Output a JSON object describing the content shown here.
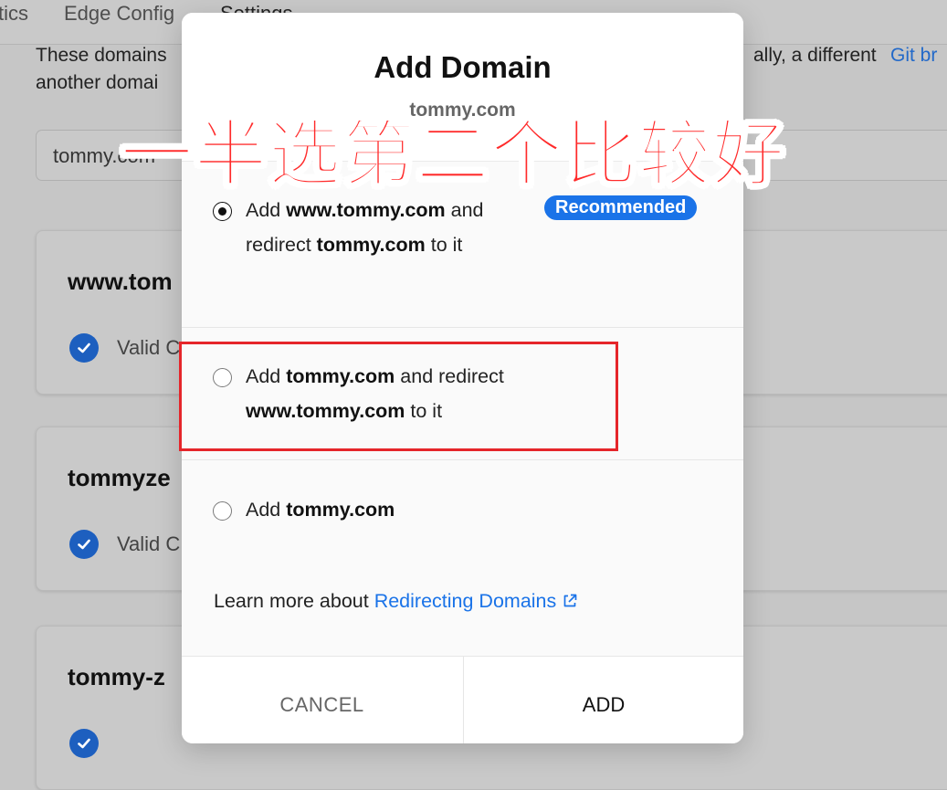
{
  "background": {
    "nav": {
      "item_1": "tics",
      "item_2": "Edge Config",
      "item_3": "Settings"
    },
    "description": {
      "line1_start": "These domains",
      "line1_end": "ally, a different",
      "line1_link": "Git br",
      "line2": "another domai"
    },
    "domain_input_value": "tommy.com",
    "cards": [
      {
        "title": "www.tom",
        "status": "Valid C"
      },
      {
        "title": "tommyze",
        "status": "Valid C"
      },
      {
        "title": "tommy-z",
        "status": ""
      }
    ]
  },
  "modal": {
    "title": "Add Domain",
    "subtitle": "tommy.com",
    "options": [
      {
        "selected": true,
        "badge": "Recommended",
        "p1": "Add ",
        "b1": "www.tommy.com",
        "p2": " and redirect ",
        "b2": "tommy.com",
        "p3": " to it"
      },
      {
        "selected": false,
        "p1": "Add ",
        "b1": "tommy.com",
        "p2": " and redirect ",
        "b2": "www.tommy.com",
        "p3": " to it"
      },
      {
        "selected": false,
        "p1": "Add ",
        "b1": "tommy.com"
      }
    ],
    "learn_more": {
      "prefix": "Learn more about ",
      "link": "Redirecting Domains"
    },
    "cancel_label": "CANCEL",
    "add_label": "ADD"
  },
  "annotation": {
    "caption": "一半选第二个比较好",
    "caption_color": "#ff2a2a",
    "box_color": "#e5252a"
  },
  "colors": {
    "accent": "#1a73e8",
    "check": "#1d5fbf"
  }
}
